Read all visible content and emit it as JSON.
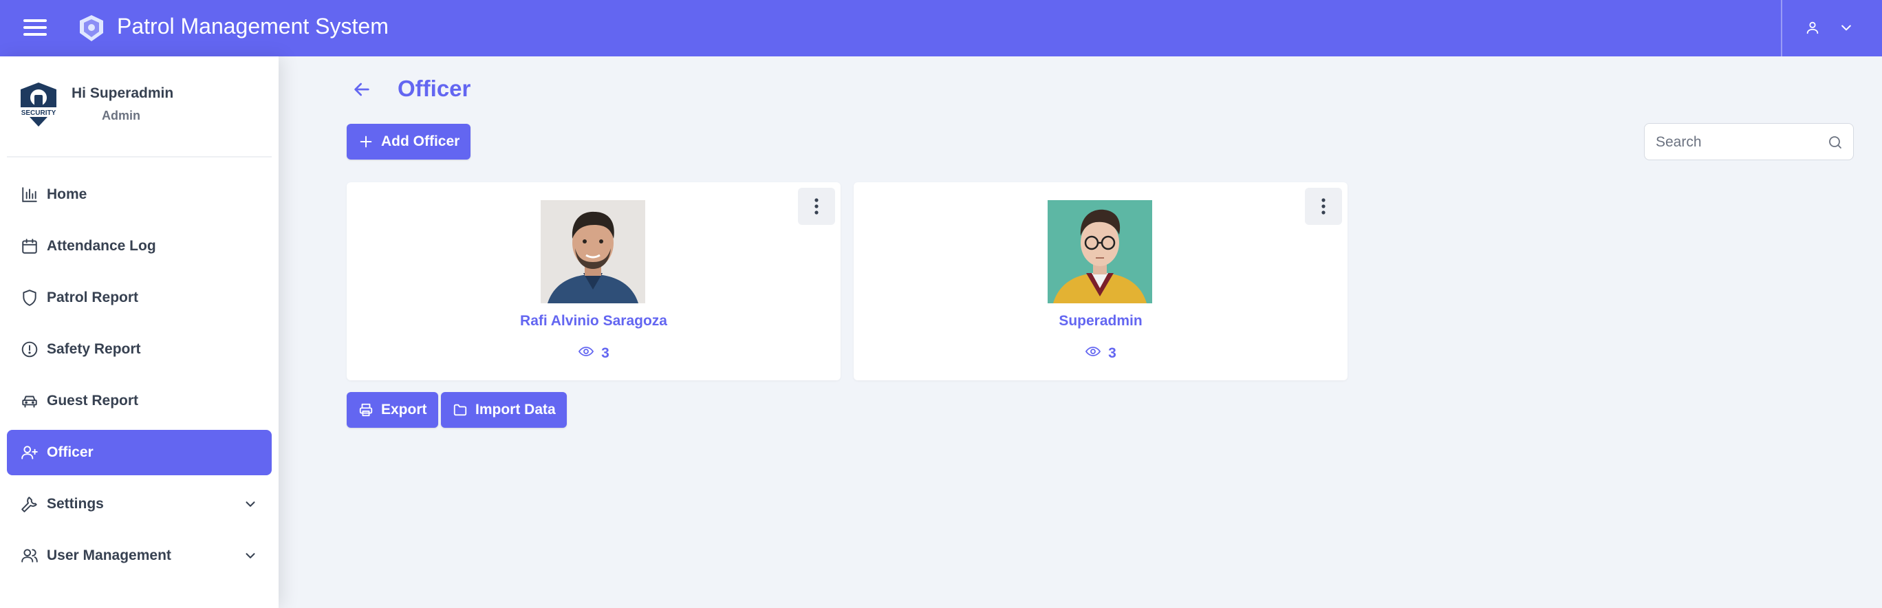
{
  "header": {
    "title": "Patrol Management System",
    "menu_icon": "hamburger-icon",
    "user_icon": "user-icon",
    "dropdown_icon": "chevron-down-icon",
    "accent_color": "#6366f1"
  },
  "sidebar": {
    "profile": {
      "greeting": "Hi Superadmin",
      "role": "Admin",
      "logo_text": "SECURITY"
    },
    "items": [
      {
        "label": "Home",
        "icon": "bar-chart-icon",
        "active": false
      },
      {
        "label": "Attendance Log",
        "icon": "calendar-icon",
        "active": false
      },
      {
        "label": "Patrol Report",
        "icon": "shield-icon",
        "active": false
      },
      {
        "label": "Safety Report",
        "icon": "alert-circle-icon",
        "active": false
      },
      {
        "label": "Guest Report",
        "icon": "car-icon",
        "active": false
      },
      {
        "label": "Officer",
        "icon": "user-plus-icon",
        "active": true
      },
      {
        "label": "Settings",
        "icon": "wrench-icon",
        "active": false,
        "expandable": true
      },
      {
        "label": "User Management",
        "icon": "users-icon",
        "active": false,
        "expandable": true
      }
    ]
  },
  "main": {
    "title": "Officer",
    "add_button": "Add Officer",
    "search_placeholder": "Search",
    "officers": [
      {
        "name": "Rafi Alvinio Saragoza",
        "views": "3"
      },
      {
        "name": "Superadmin",
        "views": "3"
      }
    ],
    "export_button": "Export",
    "import_button": "Import Data"
  }
}
